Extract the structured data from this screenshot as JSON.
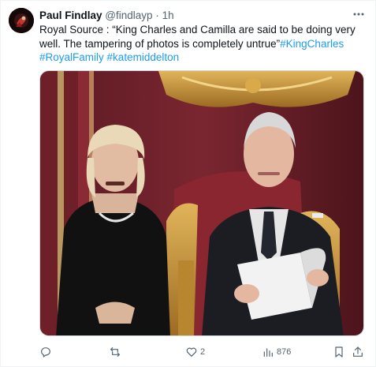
{
  "tweet": {
    "display_name": "Paul Findlay",
    "handle": "@findlayp",
    "separator": "·",
    "time": "1h",
    "body_text": "Royal Source : “King Charles and Camilla are said to be doing very well. The tampering of photos is completely untrue”",
    "hashtags": [
      "#KingCharles",
      "#RoyalFamily",
      "#katemiddelton"
    ]
  },
  "actions": {
    "reply_count": "",
    "retweet_count": "",
    "like_count": "2",
    "views_count": "876"
  },
  "icons": {
    "more": "more-options-icon",
    "reply": "reply-icon",
    "retweet": "retweet-icon",
    "like": "heart-icon",
    "views": "views-chart-icon",
    "bookmark": "bookmark-icon",
    "share": "share-icon"
  },
  "colors": {
    "text": "#0f1419",
    "muted": "#536471",
    "link": "#1d9bf0",
    "border": "#cfd9de"
  }
}
